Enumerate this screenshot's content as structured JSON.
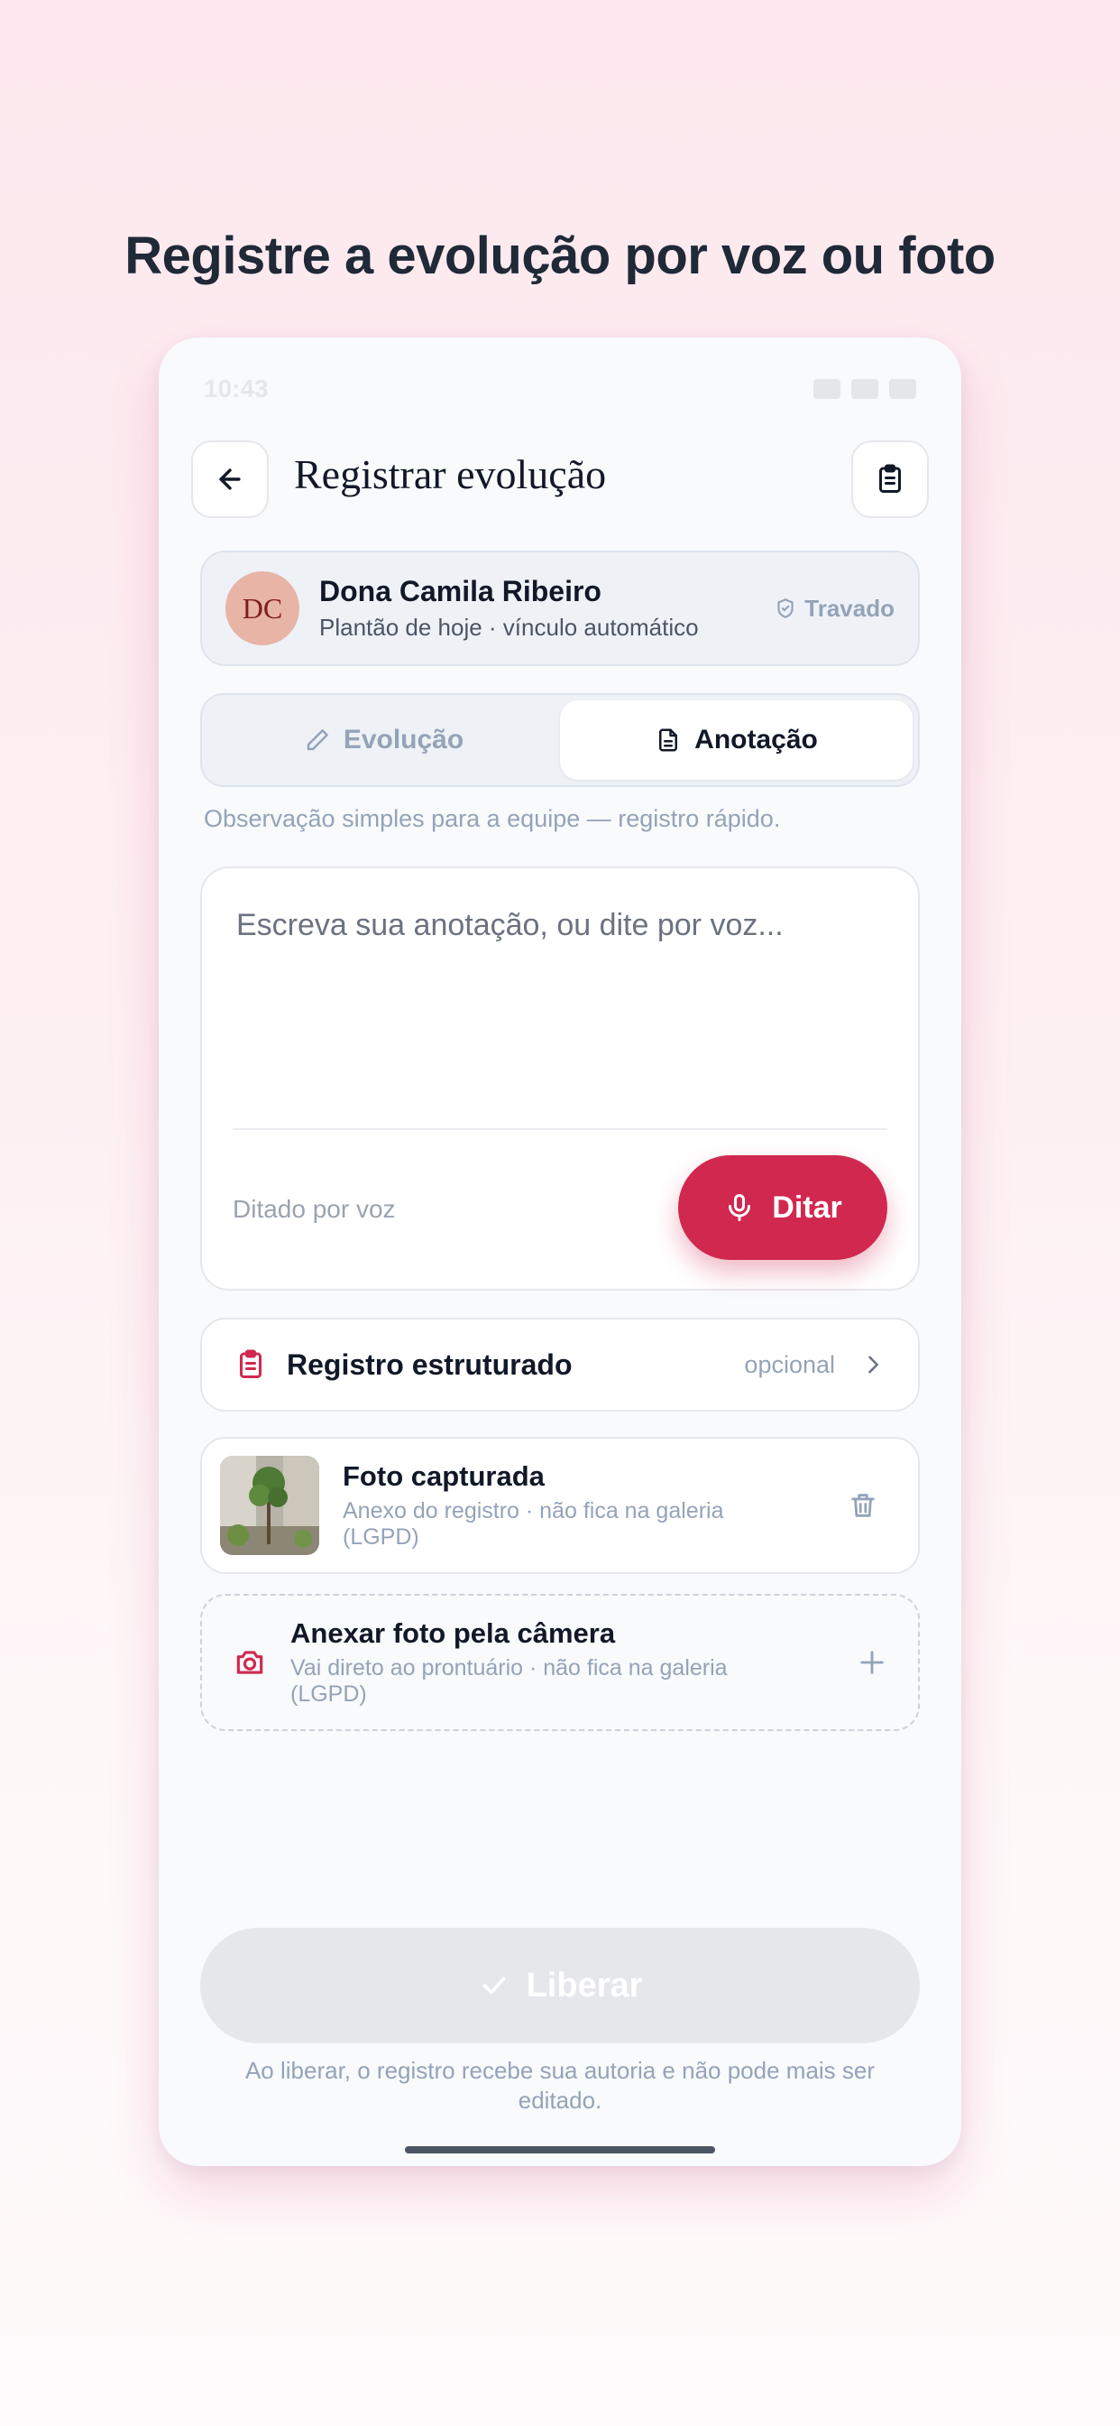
{
  "headline": "Registre a evolução por voz ou foto",
  "status_bar": {
    "time": "10:43"
  },
  "header": {
    "title": "Registrar evolução",
    "back_icon": "arrow-left-icon",
    "action_icon": "clipboard-icon"
  },
  "patient": {
    "initials": "DC",
    "name": "Dona Camila Ribeiro",
    "subtitle": "Plantão de hoje · vínculo automático",
    "lock_label": "Travado",
    "lock_icon": "shield-check-icon"
  },
  "tabs": [
    {
      "label": "Evolução",
      "icon": "pencil-icon",
      "active": false
    },
    {
      "label": "Anotação",
      "icon": "document-icon",
      "active": true
    }
  ],
  "hint": "Observação simples para a equipe — registro rápido.",
  "editor": {
    "placeholder": "Escreva sua anotação, ou dite por voz...",
    "dictation_label": "Ditado por voz",
    "mic_button_label": "Ditar"
  },
  "structured": {
    "label": "Registro estruturado",
    "tag": "opcional"
  },
  "photo": {
    "title": "Foto capturada",
    "subtitle": "Anexo do registro · não fica na galeria (LGPD)"
  },
  "attach": {
    "title": "Anexar foto pela câmera",
    "subtitle": "Vai direto ao prontuário · não fica na galeria (LGPD)"
  },
  "release": {
    "label": "Liberar",
    "enabled": false
  },
  "footnote": "Ao liberar, o registro recebe sua autoria e não pode mais ser editado.",
  "colors": {
    "accent": "#d1284f",
    "muted": "#94a3b8",
    "avatar": "#e8b4a6"
  }
}
